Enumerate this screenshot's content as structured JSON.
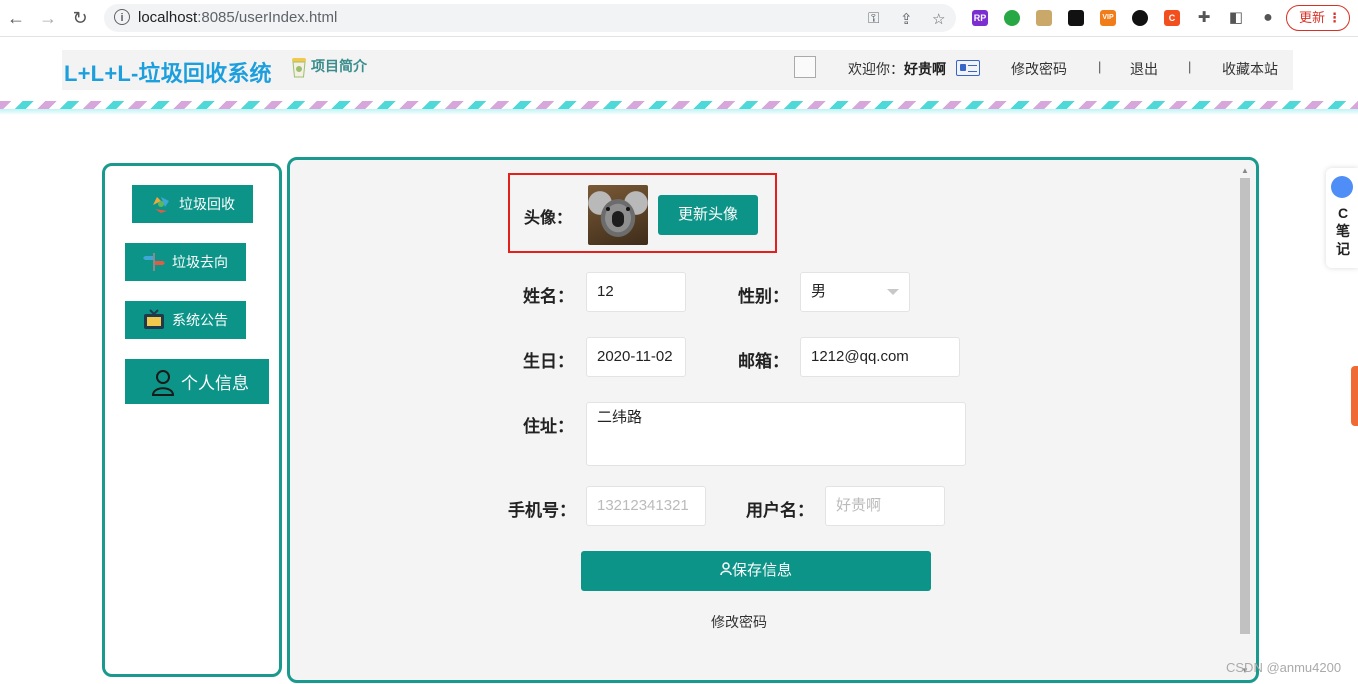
{
  "browser": {
    "url_host": "localhost",
    "url_rest": ":8085/userIndex.html",
    "update_label": "更新",
    "ext_rp": "RP",
    "ext_vip": "VIP",
    "ext_c": "C"
  },
  "header": {
    "logo": "L+L+L-垃圾回收系统",
    "intro": "项目简介",
    "welcome_prefix": "欢迎你：",
    "username": "好贵啊",
    "change_password": "修改密码",
    "sep": "|",
    "logout": "退出",
    "bookmark": "收藏本站"
  },
  "sidebar": {
    "items": [
      {
        "label": "垃圾回收",
        "icon": "recycle-icon"
      },
      {
        "label": "垃圾去向",
        "icon": "signpost-icon"
      },
      {
        "label": "系统公告",
        "icon": "notice-board-icon"
      },
      {
        "label": "个人信息",
        "icon": "user-icon"
      }
    ]
  },
  "form": {
    "avatar_label": "头像：",
    "update_avatar": "更新头像",
    "name_label": "姓名：",
    "name_value": "12",
    "gender_label": "性别：",
    "gender_value": "男",
    "birthday_label": "生日：",
    "birthday_value": "2020-11-02",
    "email_label": "邮箱：",
    "email_value": "1212@qq.com",
    "address_label": "住址：",
    "address_value": "二纬路",
    "phone_label": "手机号：",
    "phone_placeholder": "13212341321",
    "username_label": "用户名：",
    "username_placeholder": "好贵啊",
    "save_label": "保存信息",
    "change_password": "修改密码"
  },
  "float_widget": {
    "chars": [
      "C",
      "笔",
      "记"
    ]
  },
  "watermark": "CSDN @anmu4200",
  "colors": {
    "accent": "#0d9488",
    "border": "#1a9a8e",
    "logo": "#1e9fdd",
    "highlight": "#e3201c"
  }
}
